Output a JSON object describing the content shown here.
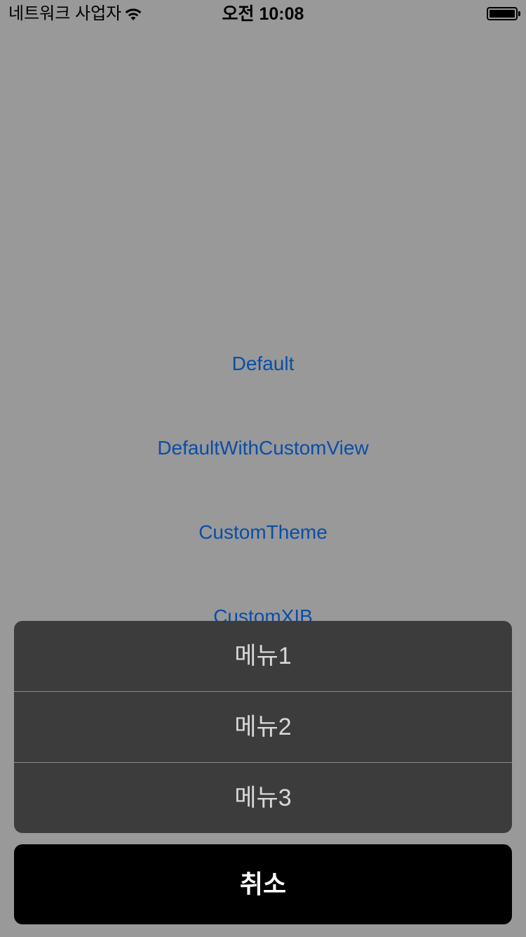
{
  "status_bar": {
    "carrier": "네트워크 사업자",
    "time": "오전 10:08"
  },
  "demo_buttons": [
    "Default",
    "DefaultWithCustomView",
    "CustomTheme",
    "CustomXIB"
  ],
  "action_sheet": {
    "items": [
      "메뉴1",
      "메뉴2",
      "메뉴3"
    ],
    "cancel": "취소"
  },
  "colors": {
    "background": "#999999",
    "link": "#0a4ea8",
    "sheet": "#3c3c3c",
    "cancel": "#000000"
  },
  "icons": {
    "wifi": "wifi-icon",
    "battery": "battery-icon"
  }
}
